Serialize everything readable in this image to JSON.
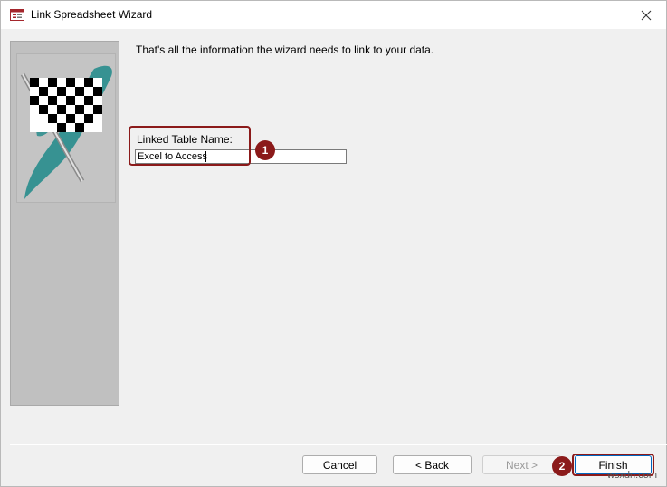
{
  "window": {
    "title": "Link Spreadsheet Wizard"
  },
  "main": {
    "intro_text": "That's all the information the wizard needs to link to your data.",
    "field_label": "Linked Table Name:",
    "field_value": "Excel to Access"
  },
  "annotations": {
    "badge_1": "1",
    "badge_2": "2"
  },
  "buttons": {
    "cancel": "Cancel",
    "back": "< Back",
    "next": "Next >",
    "finish": "Finish"
  },
  "watermark": "wsxdn.com",
  "colors": {
    "annotation": "#8b1a1a",
    "flag_teal": "#1f8a8a",
    "panel": "#c0c0c0"
  },
  "icons": {
    "app": "access-form-icon",
    "close": "close-icon",
    "side": "checkered-flag-icon"
  }
}
